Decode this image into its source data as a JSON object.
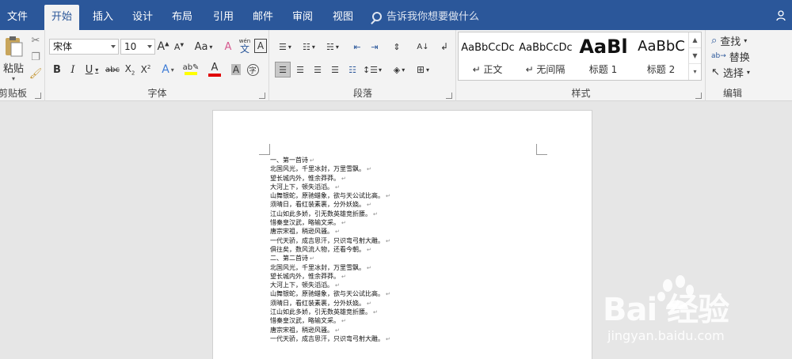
{
  "tabs": [
    {
      "label": "文件",
      "active": false
    },
    {
      "label": "开始",
      "active": true
    },
    {
      "label": "插入",
      "active": false
    },
    {
      "label": "设计",
      "active": false
    },
    {
      "label": "布局",
      "active": false
    },
    {
      "label": "引用",
      "active": false
    },
    {
      "label": "邮件",
      "active": false
    },
    {
      "label": "审阅",
      "active": false
    },
    {
      "label": "视图",
      "active": false
    }
  ],
  "tell_me": "告诉我你想要做什么",
  "clipboard": {
    "paste_label": "粘贴",
    "group_label": "剪贴板"
  },
  "font": {
    "font_name": "宋体",
    "font_size": "10",
    "case_label": "Aa",
    "group_label": "字体",
    "wen_label": "wén",
    "wen_char": "文",
    "a_box": "A"
  },
  "paragraph": {
    "group_label": "段落"
  },
  "styles": {
    "group_label": "样式",
    "items": [
      {
        "preview": "AaBbCcDc",
        "name": "↵ 正文"
      },
      {
        "preview": "AaBbCcDc",
        "name": "↵ 无间隔"
      },
      {
        "preview": "AaBl",
        "name": "标题 1"
      },
      {
        "preview": "AaBbC",
        "name": "标题 2"
      }
    ]
  },
  "editing": {
    "find": "查找",
    "replace": "替换",
    "select": "选择",
    "group_label": "编辑"
  },
  "document_lines": [
    "一、第一首诗",
    "北国风光，千里冰封，万里雪飘。",
    "望长城内外，惟余莽莽。",
    "大河上下，顿失滔滔。",
    "山舞银蛇，原驰蜡象，欲与天公试比高。",
    "须晴日，看红装素裹，分外妖娆。",
    "江山如此多娇，引无数英雄竞折腰。",
    "惜秦皇汉武，略输文采。",
    "唐宗宋祖，稍逊风骚。",
    "一代天骄，成吉思汗，只识弯弓射大雕。",
    "俱往矣，数风流人物，还看今朝。",
    "二、第二首诗",
    "北国风光，千里冰封，万里雪飘。",
    "望长城内外，惟余莽莽。",
    "大河上下，顿失滔滔。",
    "山舞银蛇，原驰蜡象，欲与天公试比高。",
    "须晴日，看红装素裹，分外妖娆。",
    "江山如此多娇，引无数英雄竞折腰。",
    "惜秦皇汉武，略输文采。",
    "唐宗宋祖，稍逊风骚。",
    "一代天骄，成吉思汗，只识弯弓射大雕。"
  ],
  "watermark": {
    "text": "Bai  经验",
    "url": "jingyan.baidu.com"
  },
  "colors": {
    "accent": "#2b579a",
    "ribbon_bg": "#f3f3f3",
    "canvas_bg": "#e6e6e6"
  }
}
